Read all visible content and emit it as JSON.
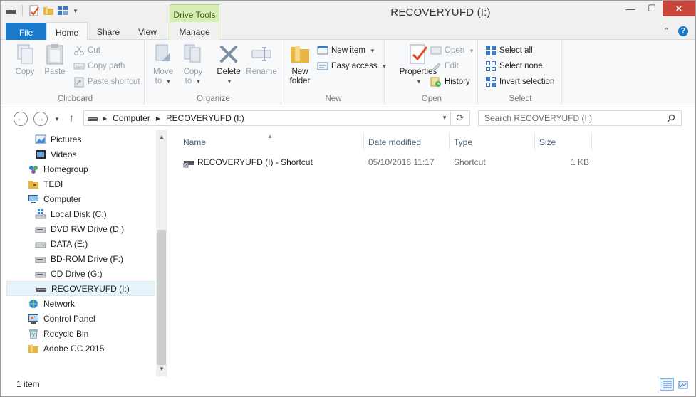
{
  "window": {
    "title": "RECOVERYUFD (I:)",
    "context_tab_group": "Drive Tools",
    "controls": {
      "minimize": "—",
      "maximize": "☐",
      "close": "✕"
    }
  },
  "tabs": {
    "file": "File",
    "home": "Home",
    "share": "Share",
    "view": "View",
    "manage": "Manage"
  },
  "ribbon": {
    "clipboard": {
      "label": "Clipboard",
      "copy": "Copy",
      "paste": "Paste",
      "cut": "Cut",
      "copy_path": "Copy path",
      "paste_shortcut": "Paste shortcut"
    },
    "organize": {
      "label": "Organize",
      "move_to_1": "Move",
      "move_to_2": "to",
      "copy_to_1": "Copy",
      "copy_to_2": "to",
      "delete": "Delete",
      "rename": "Rename"
    },
    "new": {
      "label": "New",
      "new_folder_1": "New",
      "new_folder_2": "folder",
      "new_item": "New item",
      "easy_access": "Easy access"
    },
    "open": {
      "label": "Open",
      "properties": "Properties",
      "open": "Open",
      "edit": "Edit",
      "history": "History"
    },
    "select": {
      "label": "Select",
      "select_all": "Select all",
      "select_none": "Select none",
      "invert_selection": "Invert selection"
    }
  },
  "address": {
    "segments": [
      "Computer",
      "RECOVERYUFD (I:)"
    ],
    "search_placeholder": "Search RECOVERYUFD (I:)"
  },
  "navpane": {
    "items": [
      {
        "label": "Pictures",
        "icon": "pictures-icon",
        "indent": 2
      },
      {
        "label": "Videos",
        "icon": "videos-icon",
        "indent": 2
      },
      {
        "label": "Homegroup",
        "icon": "homegroup-icon",
        "indent": 1
      },
      {
        "label": "TEDI",
        "icon": "user-folder-icon",
        "indent": 1
      },
      {
        "label": "Computer",
        "icon": "computer-icon",
        "indent": 1
      },
      {
        "label": "Local Disk (C:)",
        "icon": "windows-drive-icon",
        "indent": 2
      },
      {
        "label": "DVD RW Drive (D:)",
        "icon": "dvd-drive-icon",
        "indent": 2
      },
      {
        "label": "DATA (E:)",
        "icon": "hard-drive-icon",
        "indent": 2
      },
      {
        "label": "BD-ROM Drive (F:)",
        "icon": "bd-drive-icon",
        "indent": 2
      },
      {
        "label": "CD Drive (G:)",
        "icon": "cd-drive-icon",
        "indent": 2
      },
      {
        "label": "RECOVERYUFD (I:)",
        "icon": "usb-drive-icon",
        "indent": 2,
        "selected": true
      },
      {
        "label": "Network",
        "icon": "network-icon",
        "indent": 1
      },
      {
        "label": "Control Panel",
        "icon": "control-panel-icon",
        "indent": 1
      },
      {
        "label": "Recycle Bin",
        "icon": "recycle-bin-icon",
        "indent": 1
      },
      {
        "label": "Adobe CC 2015",
        "icon": "folder-icon",
        "indent": 1
      }
    ]
  },
  "content": {
    "columns": {
      "name": "Name",
      "date": "Date modified",
      "type": "Type",
      "size": "Size"
    },
    "files": [
      {
        "name": "RECOVERYUFD (I) - Shortcut",
        "date": "05/10/2016 11:17",
        "type": "Shortcut",
        "size": "1 KB"
      }
    ]
  },
  "status": {
    "count": "1 item"
  },
  "colors": {
    "file_tab": "#1979ca",
    "context_tab": "#d6eeb4",
    "selection": "#e5f3fb",
    "close_button": "#c7453b"
  }
}
